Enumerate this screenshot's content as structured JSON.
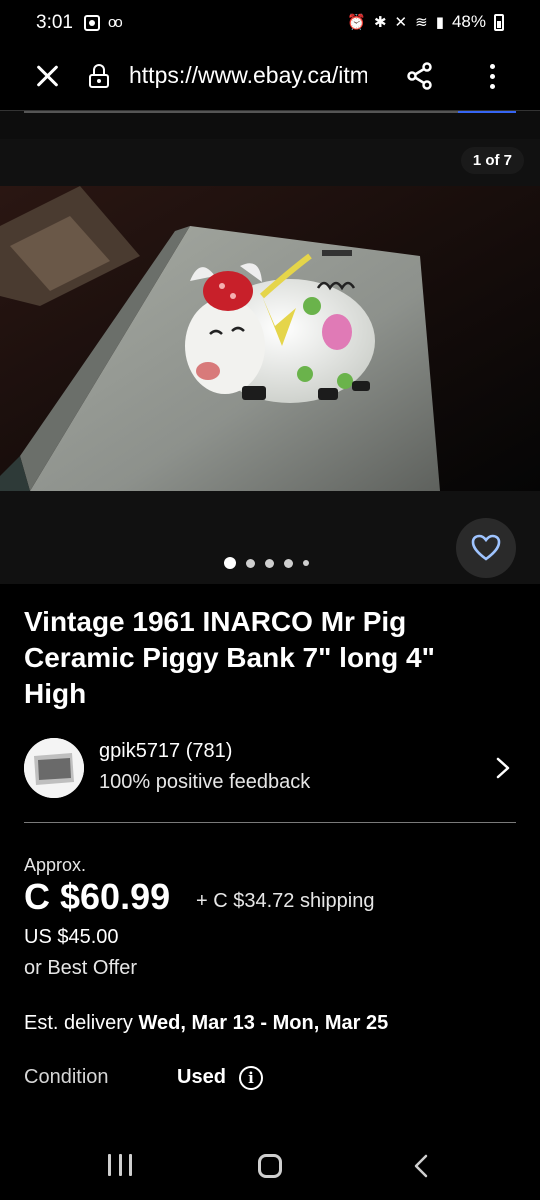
{
  "status_bar": {
    "time": "3:01",
    "battery": "48%",
    "icons": [
      "screen-record-icon",
      "voicemail-icon",
      "alarm-icon",
      "bluetooth-icon",
      "mute-icon",
      "wifi-icon",
      "signal-icon",
      "battery-icon"
    ]
  },
  "browser": {
    "url": "https://www.ebay.ca/itm/"
  },
  "gallery": {
    "counter": "1 of 7",
    "dot_count": 5,
    "active_index": 0
  },
  "listing": {
    "title": "Vintage 1961 INARCO Mr Pig Ceramic Piggy Bank 7\" long 4\" High",
    "seller": {
      "name": "gpik5717 (781)",
      "feedback": "100% positive feedback"
    },
    "price": {
      "approx_label": "Approx.",
      "amount": "C $60.99",
      "shipping": "+ C $34.72 shipping",
      "usd": "US $45.00",
      "best_offer": "or Best Offer"
    },
    "delivery": {
      "label": "Est. delivery",
      "dates": "Wed, Mar 13 - Mon, Mar 25"
    },
    "condition": {
      "label": "Condition",
      "value": "Used"
    }
  },
  "colors": {
    "background": "#000000",
    "accent": "#3665f3",
    "text": "#ffffff"
  }
}
